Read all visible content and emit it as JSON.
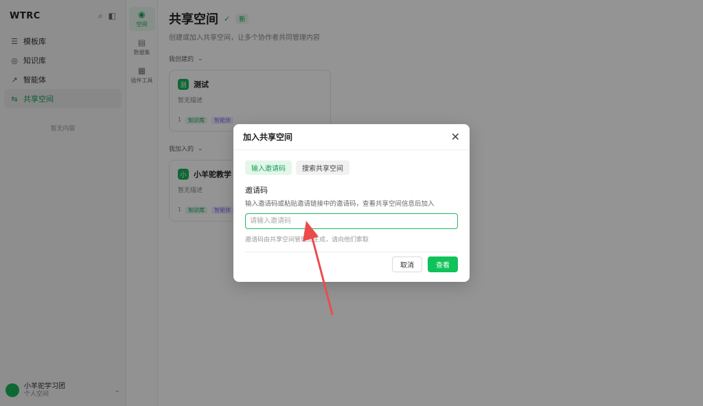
{
  "app": {
    "logo": "WTRC",
    "sidebar": {
      "items": [
        {
          "icon": "☰",
          "label": "模板库"
        },
        {
          "icon": "◎",
          "label": "知识库"
        },
        {
          "icon": "↗",
          "label": "智能体"
        },
        {
          "icon": "⇆",
          "label": "共享空间"
        }
      ],
      "note": "暂无内容",
      "user_name": "小羊驼学习团",
      "user_sub": "个人空间"
    },
    "rail": {
      "items": [
        {
          "icon": "◉",
          "label": "空间"
        },
        {
          "icon": "▤",
          "label": "数据集"
        },
        {
          "icon": "▦",
          "label": "插件工具"
        }
      ]
    },
    "main": {
      "title": "共享空间",
      "badge": "新",
      "subtitle": "创建或加入共享空间，让多个协作者共同管理内容",
      "sections": [
        {
          "label": "我创建的",
          "cards": [
            {
              "icon": "测",
              "name": "测试",
              "desc": "暂无描述",
              "count": "1",
              "tag1": "知识库",
              "tag2": "智能体"
            }
          ]
        },
        {
          "label": "我加入的",
          "cards": [
            {
              "icon": "小",
              "name": "小羊驼教学",
              "desc": "暂无描述",
              "count": "1",
              "tag1": "知识库",
              "tag2": "智能体"
            }
          ]
        }
      ]
    }
  },
  "modal": {
    "title": "加入共享空间",
    "close_icon": "close-icon",
    "tabs": [
      {
        "label": "输入邀请码",
        "active": true
      },
      {
        "label": "搜索共享空间",
        "active": false
      }
    ],
    "field_label": "邀请码",
    "field_desc": "输入邀请码或粘贴邀请链接中的邀请码，查看共享空间信息后加入",
    "input_placeholder": "请输入邀请码",
    "input_value": "",
    "hint": "邀请码由共享空间管理员生成，请向他们索取",
    "cancel_label": "取消",
    "confirm_label": "查看"
  },
  "colors": {
    "accent": "#10c25a",
    "annotation_arrow": "#ee4b4b",
    "overlay": "rgba(0,0,0,0.42)"
  }
}
